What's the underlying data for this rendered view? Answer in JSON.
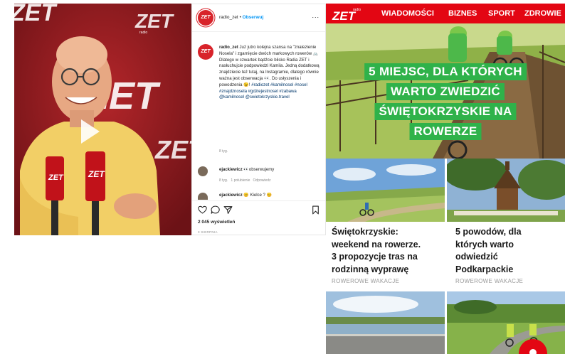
{
  "instagram": {
    "media": {
      "brand_text": "ZET",
      "brand_small": "radio"
    },
    "header": {
      "username": "radio_zet",
      "separator": "•",
      "follow_label": "Obserwuj",
      "more_label": "..."
    },
    "caption": {
      "username": "radio_zet",
      "parts": {
        "p1": "Już jutro kolejna szansa na \"znalezienie Nosela\" i zgarnięcie dwóch markowych rowerów",
        "p2": "Dlatego w czwartek bądźcie blisko Radia ZET i nasłuchujcie podpowiedzi Kamila. Jedną dodatkową znajdziecie też tutaj, na Instagramie, dlatego równie ważna jest obserwacja",
        "p3": ". Do usłyszenia i powodzenia",
        "p4": "!"
      },
      "hashtags": {
        "h1": "#radiozet",
        "h2": "#kamilnosel",
        "h3": "#nosel",
        "h4": "#znajdznosela",
        "h5": "#gdziejestnosel",
        "h6": "#zabawa",
        "h7": "@kamilnosel",
        "h8": "@swietokrzyskie.travel"
      },
      "time": "8 tyg."
    },
    "comment": {
      "username": "ejackiewicz",
      "text": "obserwujemy",
      "time": "8 tyg.",
      "likes": "1 polubienie",
      "reply_label": "Odpowiedz"
    },
    "comment2": {
      "username": "ejackiewicz",
      "text": "Kielce ?"
    },
    "views": "2 045 wyświetleń",
    "date": "3 SIERPNIA"
  },
  "site": {
    "logo": {
      "small": "radio",
      "big": "ZET"
    },
    "nav": [
      "WIADOMOŚCI",
      "BIZNES",
      "SPORT",
      "ZDROWIE"
    ],
    "hero_lines": [
      "5 MIEJSC, DLA KTÓRYCH",
      "WARTO ZWIEDZIĆ",
      "ŚWIĘTOKRZYSKIE NA",
      "ROWERZE"
    ],
    "cards": [
      {
        "title_lines": [
          "Świętokrzyskie:",
          "weekend na rowerze.",
          "3 propozycje tras na",
          "rodzinną wyprawę"
        ],
        "category": "ROWEROWE WAKACJE"
      },
      {
        "title_lines": [
          "5 powodów, dla",
          "których warto",
          "odwiedzić",
          "Podkarpackie"
        ],
        "category": "ROWEROWE WAKACJE"
      }
    ]
  },
  "colors": {
    "brand_red": "#e30613",
    "hero_green": "#2fb24a",
    "ig_link": "#0095f6"
  },
  "icons": [
    "play-icon",
    "heart-icon",
    "comment-icon",
    "share-icon",
    "bookmark-icon"
  ]
}
